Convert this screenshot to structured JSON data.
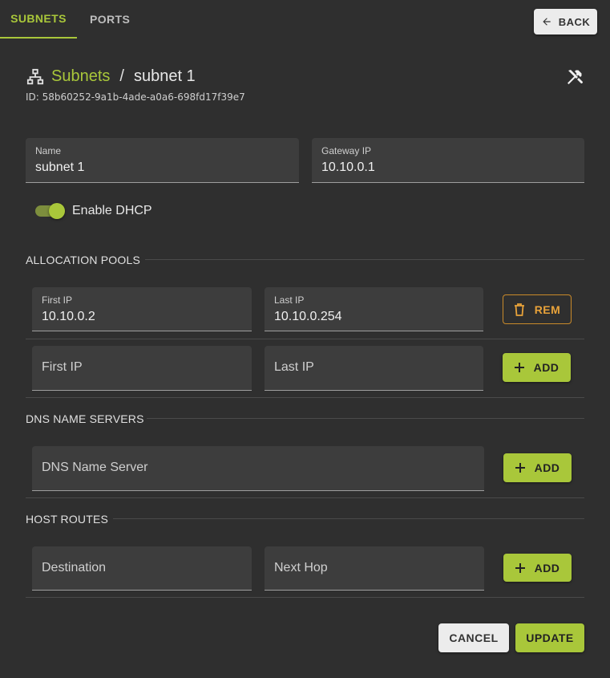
{
  "tabs": [
    {
      "label": "SUBNETS",
      "active": true
    },
    {
      "label": "PORTS",
      "active": false
    }
  ],
  "back_label": "BACK",
  "breadcrumb": {
    "parent": "Subnets",
    "separator": "/",
    "current": "subnet 1"
  },
  "id_line": "ID: 58b60252-9a1b-4ade-a0a6-698fd17f39e7",
  "form": {
    "name": {
      "label": "Name",
      "value": "subnet 1"
    },
    "gateway": {
      "label": "Gateway IP",
      "value": "10.10.0.1"
    },
    "dhcp": {
      "label": "Enable DHCP",
      "enabled": true
    }
  },
  "allocation": {
    "title": "ALLOCATION POOLS",
    "pool": {
      "first_label": "First IP",
      "first_value": "10.10.0.2",
      "last_label": "Last IP",
      "last_value": "10.10.0.254",
      "remove_label": "REM"
    },
    "new": {
      "first_placeholder": "First IP",
      "last_placeholder": "Last IP",
      "add_label": "ADD"
    }
  },
  "dns": {
    "title": "DNS NAME SERVERS",
    "placeholder": "DNS Name Server",
    "add_label": "ADD"
  },
  "routes": {
    "title": "HOST ROUTES",
    "destination_placeholder": "Destination",
    "next_hop_placeholder": "Next Hop",
    "add_label": "ADD"
  },
  "footer": {
    "cancel_label": "CANCEL",
    "update_label": "UPDATE"
  },
  "colors": {
    "accent": "#a9c73a",
    "warning": "#e8a23a",
    "background": "#2f2f2f"
  }
}
